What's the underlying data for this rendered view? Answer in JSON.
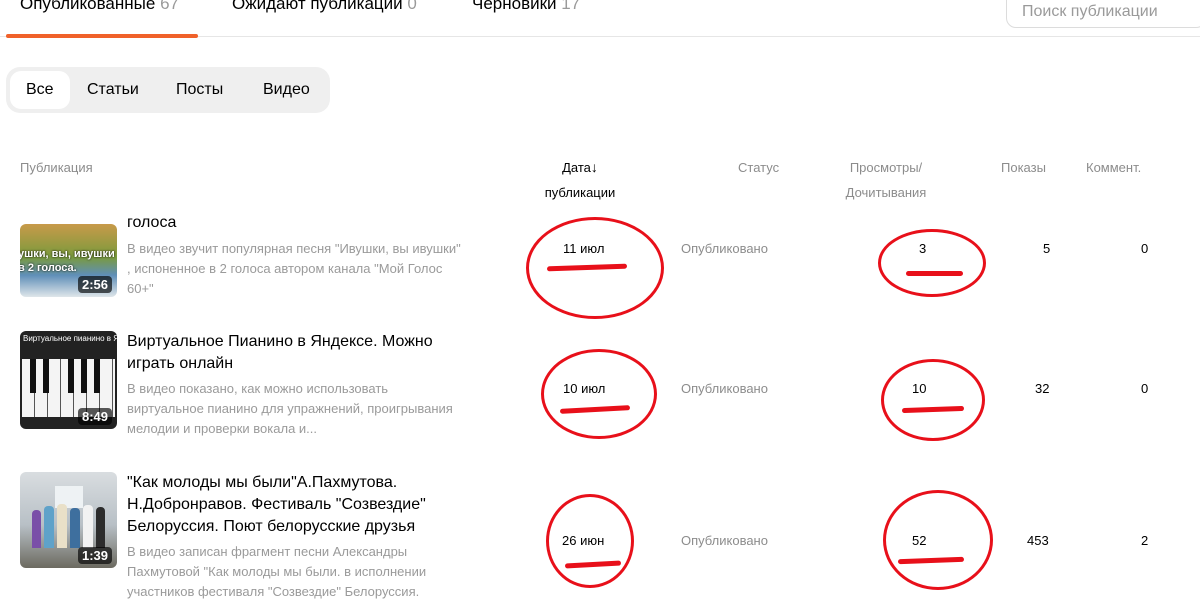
{
  "top_tabs": [
    {
      "label": "Опубликованные",
      "count": "67"
    },
    {
      "label": "Ожидают публикации",
      "count": "0"
    },
    {
      "label": "Черновики",
      "count": "17"
    }
  ],
  "search": {
    "placeholder": "Поиск публикации"
  },
  "filters": [
    "Все",
    "Статьи",
    "Посты",
    "Видео"
  ],
  "columns": {
    "publication": "Публикация",
    "date_line1": "Дата",
    "date_line2": "публикации",
    "sort_arrow": "↓",
    "status": "Статус",
    "views_line1": "Просмотры/",
    "views_line2": "Дочитывания",
    "shows": "Показы",
    "comments": "Коммент."
  },
  "rows": [
    {
      "title": "голоса",
      "desc": "В видео звучит популярная песня \"Ивушки, вы ивушки\" , испоненное в 2 голоса автором канала \"Мой Голос 60+\"",
      "duration": "2:56",
      "thumb_text": "ушки, вы, ивушки в 2 голоса.",
      "date": "11 июл",
      "status": "Опубликовано",
      "views": "3",
      "shows": "5",
      "comments": "0"
    },
    {
      "title": "Виртуальное Пианино в Яндексе. Можно играть онлайн",
      "desc": "В видео показано, как можно использовать виртуальное пианино для упражнений, проигрывания мелодии и проверки вокала и...",
      "duration": "8:49",
      "thumb_text": "Виртуальное пианино в Яндексе",
      "date": "10 июл",
      "status": "Опубликовано",
      "views": "10",
      "shows": "32",
      "comments": "0"
    },
    {
      "title": "\"Как молоды мы были\"А.Пахмутова. Н.Добронравов. Фестиваль \"Созвездие\" Белоруссия. Поют белорусские друзья",
      "desc": "В видео записан фрагмент песни Александры Пахмутовой \"Как молоды мы были. в исполнении участников фестиваля \"Созвездие\" Белоруссия.",
      "duration": "1:39",
      "date": "26 июн",
      "status": "Опубликовано",
      "views": "52",
      "shows": "453",
      "comments": "2"
    }
  ],
  "colors": {
    "accent": "#f0612a",
    "annotation": "#e8101a"
  }
}
